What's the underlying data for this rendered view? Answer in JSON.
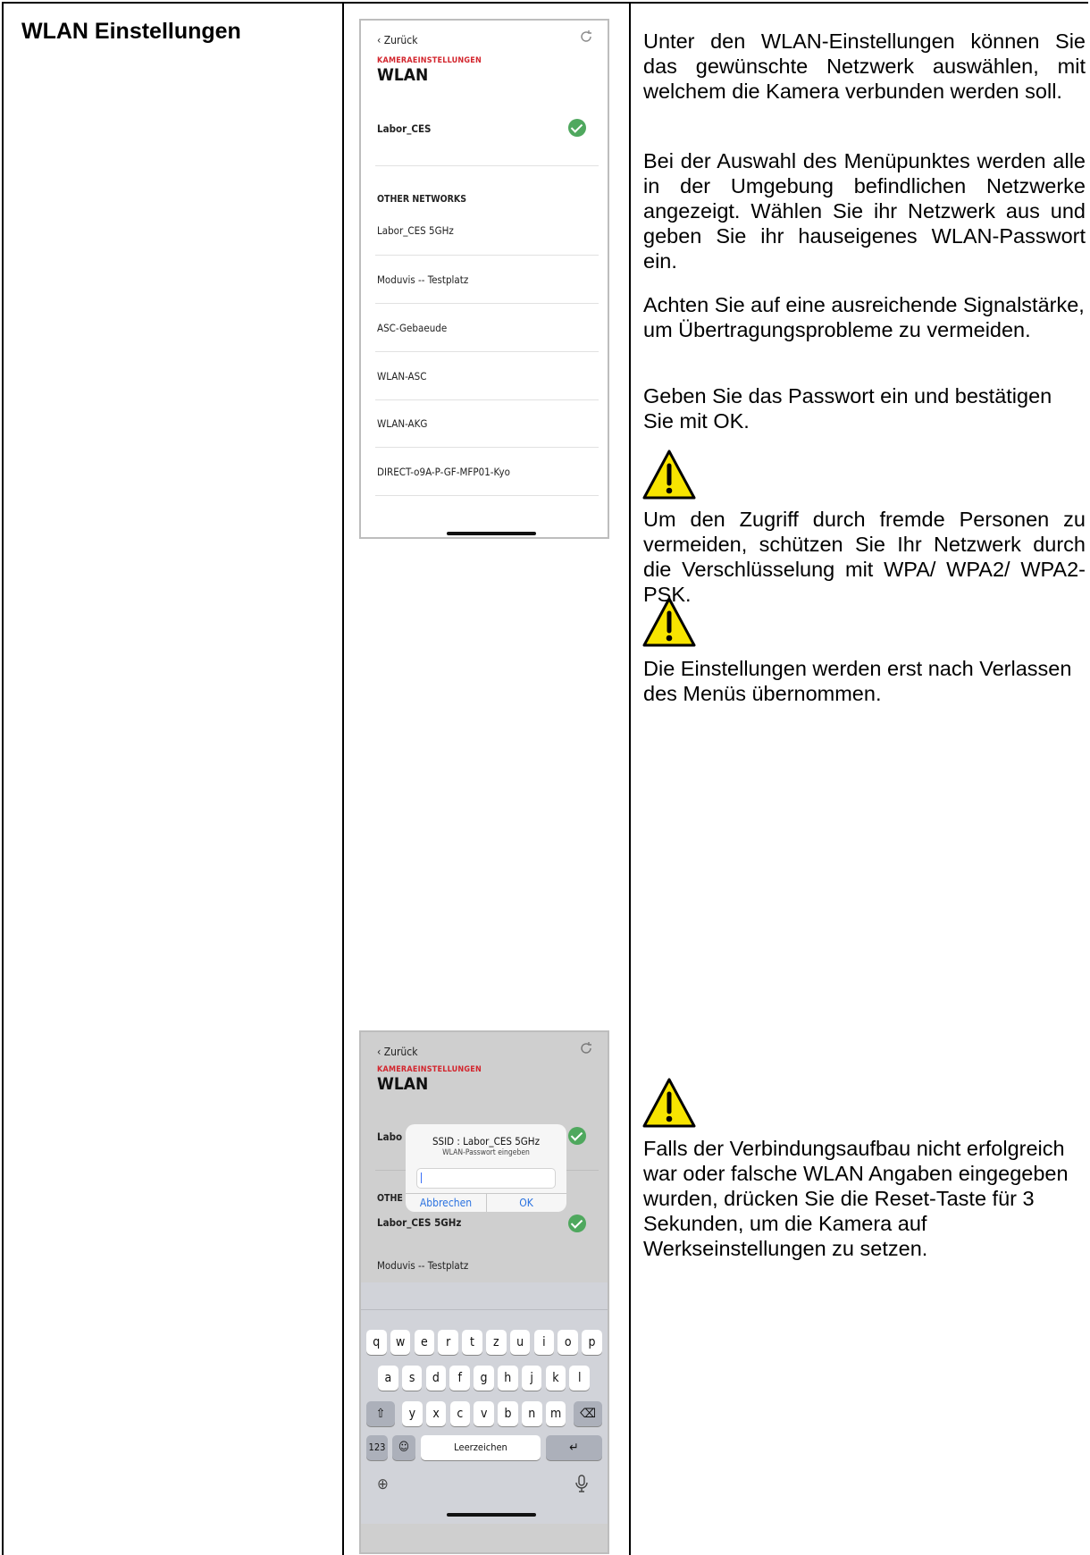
{
  "section_title": "WLAN Einstellungen",
  "phone1": {
    "back_label": "Zurück",
    "kicker": "KAMERAEINSTELLUNGEN",
    "title": "WLAN",
    "connected_network": "Labor_CES",
    "other_header": "OTHER NETWORKS",
    "networks": [
      "Labor_CES 5GHz",
      "Moduvis -- Testplatz",
      "ASC-Gebaeude",
      "WLAN-ASC",
      "WLAN-AKG",
      "DIRECT-o9A-P-GF-MFP01-Kyo"
    ]
  },
  "phone2": {
    "back_label": "Zurück",
    "kicker": "KAMERAEINSTELLUNGEN",
    "title": "WLAN",
    "partial_network": "Labo",
    "partial_header": "OTHE",
    "selected_network": "Labor_CES 5GHz",
    "next_network": "Moduvis -- Testplatz",
    "dialog": {
      "title": "SSID : Labor_CES 5GHz",
      "subtitle": "WLAN-Passwort eingeben",
      "password_value": "",
      "cancel_label": "Abbrechen",
      "ok_label": "OK"
    },
    "keyboard": {
      "row1": [
        "q",
        "w",
        "e",
        "r",
        "t",
        "z",
        "u",
        "i",
        "o",
        "p"
      ],
      "row2": [
        "a",
        "s",
        "d",
        "f",
        "g",
        "h",
        "j",
        "k",
        "l"
      ],
      "row3": [
        "y",
        "x",
        "c",
        "v",
        "b",
        "n",
        "m"
      ],
      "numbers_key": "123",
      "space_label": "Leerzeichen"
    }
  },
  "texts": {
    "p1": "Unter den WLAN-Einstellungen können Sie das gewünschte Netzwerk auswählen, mit welchem die Kamera verbunden werden soll.",
    "p2": "Bei der Auswahl des Menüpunktes werden alle in der Umgebung befindlichen Netzwerke angezeigt. Wählen Sie ihr Netzwerk aus und geben Sie ihr hauseigenes WLAN-Passwort ein.",
    "p3": "Achten Sie auf eine ausreichende Signalstärke, um Übertragungsprobleme zu vermeiden.",
    "p4": "Geben Sie das Passwort ein und bestätigen Sie mit OK.",
    "p5": "Um den Zugriff durch fremde Personen zu vermeiden, schützen Sie Ihr Netzwerk durch die Verschlüsselung mit WPA/ WPA2/ WPA2-PSK.",
    "p6": "Die Einstellungen werden erst nach Verlassen des Menüs übernommen.",
    "p7": "Falls der Verbindungsaufbau nicht erfolgreich war oder falsche WLAN Angaben eingegeben wurden, drücken Sie die Reset-Taste für 3 Sekunden, um die Kamera auf Werkseinstellungen zu setzen."
  },
  "colors": {
    "accent_red": "#d3262e",
    "check_green": "#4fa85e",
    "link_blue": "#2a72e0",
    "warning_yellow": "#f7e400"
  }
}
